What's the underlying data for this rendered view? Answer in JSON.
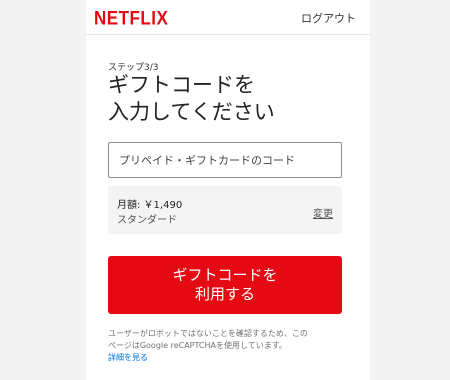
{
  "header": {
    "logo_text": "NETFLIX",
    "logout_label": "ログアウト"
  },
  "main": {
    "step_label": "ステップ3/3",
    "title_lines": [
      "ギフトコードを",
      "入力してください"
    ],
    "code_input": {
      "placeholder": "プリペイド・ギフトカードのコード",
      "value": ""
    },
    "plan": {
      "price": "月額: ￥1,490",
      "name": "スタンダード",
      "change_label": "変更"
    },
    "redeem_button_lines": [
      "ギフトコードを",
      "利用する"
    ],
    "recaptcha_lines": [
      "ユーザーがロボットではないことを確認するため、この",
      "ページはGoogle reCAPTCHAを使用しています。"
    ],
    "learn_more_label": "詳細を見る"
  },
  "colors": {
    "brand": "#e50914",
    "link": "#0071eb",
    "page_background": "#f3f3f3"
  }
}
